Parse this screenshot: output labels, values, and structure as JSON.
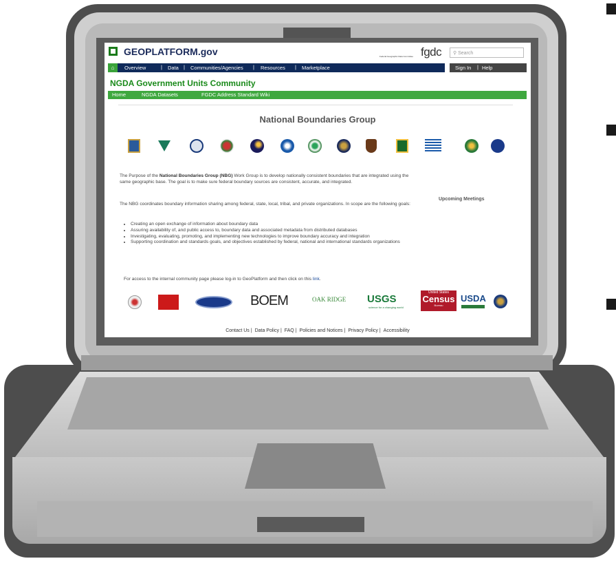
{
  "site": {
    "logo_text": "GEOPLATFORM.gov",
    "fgdc_small": "Federal Geographic Data Committee",
    "fgdc_logo": "fgdc",
    "search_placeholder": "Search",
    "search_icon": "magnifier-icon"
  },
  "nav": {
    "home_icon": "home-icon",
    "items": [
      "Overview",
      "Data",
      "Communities/Agencies",
      "Resources",
      "Marketplace"
    ],
    "signin": "Sign In",
    "help": "Help"
  },
  "community": {
    "title": "NGDA Government Units Community",
    "subnav": [
      "Home",
      "NGDA Datasets",
      "FGDC Address Standard Wiki"
    ]
  },
  "main": {
    "page_title": "National Boundaries Group",
    "intro_pre": "The Purpose of the ",
    "intro_bold": "National Boundaries Group (NBG)",
    "intro_post": " Work Group is to develop nationally consistent boundaries that are integrated using the same geographic base. The goal is to make sure federal boundary sources are consistent, accurate, and integrated.",
    "coordination": "The NBG coordinates boundary information sharing among federal, state, local, tribal, and private organizations. In scope are the following goals:",
    "goals": [
      "Creating an open exchange of information about boundary data",
      "Assuring availability of, and public access to, boundary data and associated metadata from distributed databases",
      "Investigating, evaluating, promoting, and implementing new technologies to improve boundary accuracy and integration",
      "Supporting coordination and standards goals, and objectives established by federal, national and international standards organizations"
    ],
    "access_text": "For access to the internal community page please log-in to GeoPlatform and then click on this ",
    "access_link": "link",
    "access_end": ".",
    "upcoming": "Upcoming Meetings"
  },
  "partners": {
    "boem": "BOEM",
    "oak_ridge": "OAK RIDGE",
    "usgs": "USGS",
    "usgs_tag": "science for a changing world",
    "census_top": "United States",
    "census": "Census",
    "census_bottom": "Bureau",
    "usda": "USDA"
  },
  "footer": [
    "Contact Us",
    "Data Policy",
    "FAQ",
    "Policies and Notices",
    "Privacy Policy",
    "Accessibility"
  ],
  "colors": {
    "brand_green": "#3fa83f",
    "nav_navy": "#0f2a5a",
    "frame_gray": "#4d4d4d"
  }
}
